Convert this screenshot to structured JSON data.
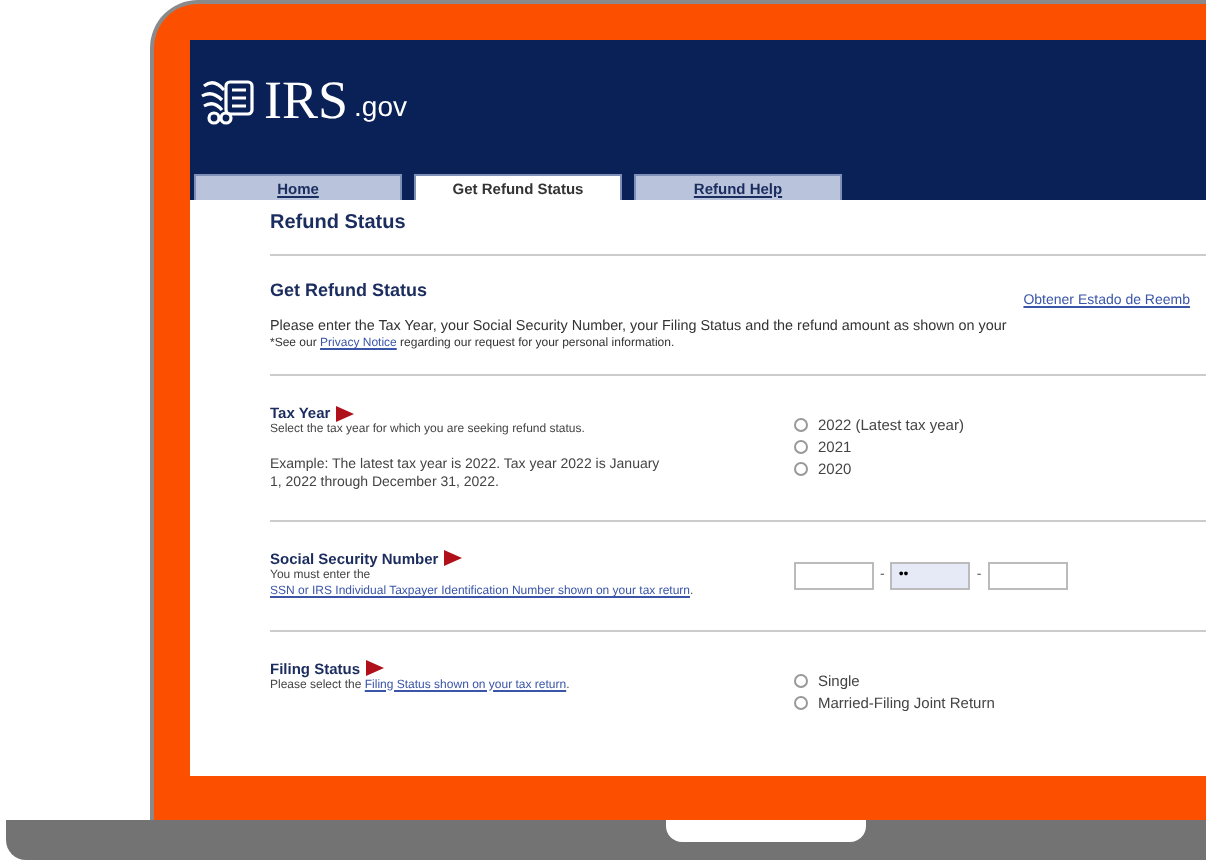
{
  "site": {
    "logo_text": "IRS",
    "logo_suffix": ".gov"
  },
  "tabs": [
    {
      "label": "Home",
      "selected": false
    },
    {
      "label": "Get Refund Status",
      "selected": true
    },
    {
      "label": "Refund Help",
      "selected": false
    }
  ],
  "page_title": "Refund Status",
  "intro": {
    "heading": "Get Refund Status",
    "spanish_link": "Obtener Estado de Reemb",
    "text": "Please enter the Tax Year, your Social Security Number, your Filing Status and the refund amount as shown on your",
    "privacy": {
      "before": "*See our ",
      "link": "Privacy Notice",
      "after": " regarding our request for your personal information."
    }
  },
  "sections": [
    {
      "title": "Tax Year",
      "help": [
        {
          "before": "Select the tax year for which you are seeking refund status."
        },
        {
          "before": "Example: The latest tax year is 2022. Tax year 2022 is January 1, 2022 through December 31, 2022."
        }
      ],
      "kind": "radio",
      "options": [
        {
          "label": "2022 (Latest tax year)",
          "selected": false
        },
        {
          "label": "2021",
          "selected": false
        },
        {
          "label": "2020",
          "selected": false
        }
      ]
    },
    {
      "title": "Social Security Number",
      "help": [
        {
          "before": "You must enter the ",
          "link": "SSN or IRS Individual Taxpayer Identification Number shown on your tax return",
          "after": "."
        }
      ],
      "kind": "ssn",
      "fields": [
        {
          "filled": false
        },
        {
          "filled": true,
          "value": "••"
        },
        {
          "filled": false
        }
      ],
      "separator": "-"
    },
    {
      "title": "Filing Status",
      "help": [
        {
          "before": "Please select the ",
          "link": "Filing Status shown on your tax return",
          "after": "."
        }
      ],
      "kind": "radio",
      "options": [
        {
          "label": "Single",
          "selected": false
        },
        {
          "label": "Married-Filing Joint Return",
          "selected": false
        }
      ]
    }
  ]
}
